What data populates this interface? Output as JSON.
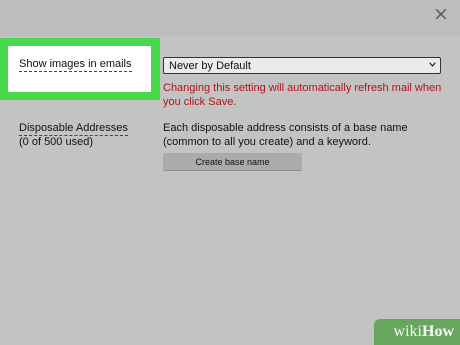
{
  "dialog": {
    "close_symbol": "×"
  },
  "settings": {
    "show_images": {
      "label": "Show images in emails",
      "selected": "Never by Default",
      "warning": "Changing this setting will automatically refresh mail when you click Save."
    },
    "disposable": {
      "label": "Disposable Addresses",
      "count": "(0 of 500 used)",
      "description": "Each disposable address consists of a base name (common to all you create) and a keyword.",
      "button_label": "Create base name"
    }
  },
  "watermark": {
    "prefix": "wiki",
    "suffix": "How"
  },
  "colors": {
    "highlight": "#47d94b",
    "warning_text": "#b3131d",
    "background": "#bdbdbd"
  },
  "icons": [
    "close-icon",
    "chevron-down-icon"
  ]
}
